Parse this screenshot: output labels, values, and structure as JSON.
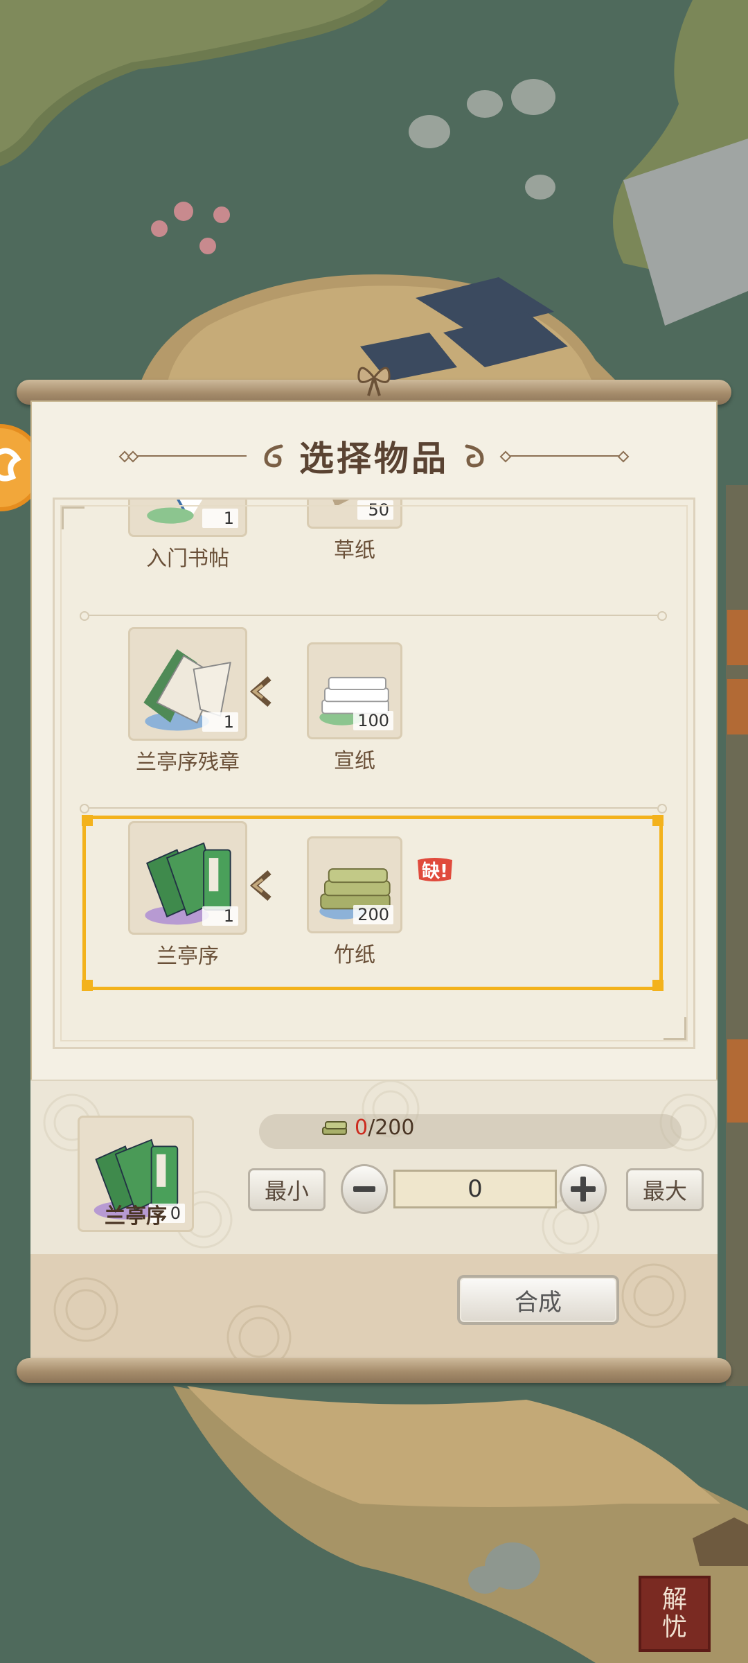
{
  "dialog": {
    "title": "选择物品"
  },
  "recipes": [
    {
      "output": {
        "name": "入门书帖",
        "count": "1"
      },
      "input": {
        "name": "草纸",
        "count": "50"
      },
      "missing": false
    },
    {
      "output": {
        "name": "兰亭序残章",
        "count": "1"
      },
      "input": {
        "name": "宣纸",
        "count": "100"
      },
      "missing": false
    },
    {
      "output": {
        "name": "兰亭序",
        "count": "1"
      },
      "input": {
        "name": "竹纸",
        "count": "200"
      },
      "missing": true,
      "missing_label": "缺!",
      "selected": true
    }
  ],
  "craft": {
    "result_name": "兰亭序",
    "result_count": "0",
    "cost_have": "0",
    "cost_need": "/200",
    "min_label": "最小",
    "max_label": "最大",
    "quantity": "0",
    "button_label": "合成"
  },
  "corner_seal": {
    "text_top": "解",
    "text_bottom": "忧"
  },
  "colors": {
    "selection": "#f3b21c",
    "missing": "#cc2a1e",
    "title": "#5a4332"
  }
}
